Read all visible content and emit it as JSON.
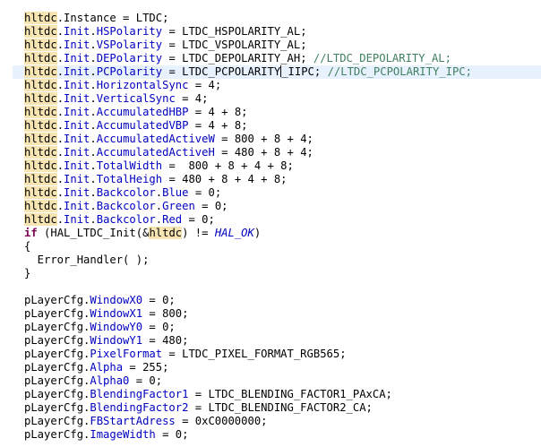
{
  "editor": {
    "caret_line": 4,
    "lines": [
      [
        {
          "t": "hl",
          "s": "hltdc"
        },
        {
          "t": "",
          "s": ".Instance = LTDC;"
        }
      ],
      [
        {
          "t": "hl",
          "s": "hltdc"
        },
        {
          "t": "",
          "s": "."
        },
        {
          "t": "fld",
          "s": "Init"
        },
        {
          "t": "",
          "s": "."
        },
        {
          "t": "fld",
          "s": "HSPolarity"
        },
        {
          "t": "",
          "s": " = LTDC_HSPOLARITY_AL;"
        }
      ],
      [
        {
          "t": "hl",
          "s": "hltdc"
        },
        {
          "t": "",
          "s": "."
        },
        {
          "t": "fld",
          "s": "Init"
        },
        {
          "t": "",
          "s": "."
        },
        {
          "t": "fld",
          "s": "VSPolarity"
        },
        {
          "t": "",
          "s": " = LTDC_VSPOLARITY_AL;"
        }
      ],
      [
        {
          "t": "hl",
          "s": "hltdc"
        },
        {
          "t": "",
          "s": "."
        },
        {
          "t": "fld",
          "s": "Init"
        },
        {
          "t": "",
          "s": "."
        },
        {
          "t": "fld",
          "s": "DEPolarity"
        },
        {
          "t": "",
          "s": " = LTDC_DEPOLARITY_AH; "
        },
        {
          "t": "cm",
          "s": "//LTDC_DEPOLARITY_AL;"
        }
      ],
      [
        {
          "t": "hl",
          "s": "hltdc"
        },
        {
          "t": "",
          "s": "."
        },
        {
          "t": "fld",
          "s": "Init"
        },
        {
          "t": "",
          "s": "."
        },
        {
          "t": "fld",
          "s": "PCPolarity"
        },
        {
          "t": "",
          "s": " = LTDC_PCPOLARITY"
        },
        {
          "t": "caret",
          "s": ""
        },
        {
          "t": "",
          "s": "_IIPC; "
        },
        {
          "t": "cm",
          "s": "//LTDC_PCPOLARITY_IPC;"
        }
      ],
      [
        {
          "t": "hl",
          "s": "hltdc"
        },
        {
          "t": "",
          "s": "."
        },
        {
          "t": "fld",
          "s": "Init"
        },
        {
          "t": "",
          "s": "."
        },
        {
          "t": "fld",
          "s": "HorizontalSync"
        },
        {
          "t": "",
          "s": " = 4;"
        }
      ],
      [
        {
          "t": "hl",
          "s": "hltdc"
        },
        {
          "t": "",
          "s": "."
        },
        {
          "t": "fld",
          "s": "Init"
        },
        {
          "t": "",
          "s": "."
        },
        {
          "t": "fld",
          "s": "VerticalSync"
        },
        {
          "t": "",
          "s": " = 4;"
        }
      ],
      [
        {
          "t": "hl",
          "s": "hltdc"
        },
        {
          "t": "",
          "s": "."
        },
        {
          "t": "fld",
          "s": "Init"
        },
        {
          "t": "",
          "s": "."
        },
        {
          "t": "fld",
          "s": "AccumulatedHBP"
        },
        {
          "t": "",
          "s": " = 4 + 8;"
        }
      ],
      [
        {
          "t": "hl",
          "s": "hltdc"
        },
        {
          "t": "",
          "s": "."
        },
        {
          "t": "fld",
          "s": "Init"
        },
        {
          "t": "",
          "s": "."
        },
        {
          "t": "fld",
          "s": "AccumulatedVBP"
        },
        {
          "t": "",
          "s": " = 4 + 8;"
        }
      ],
      [
        {
          "t": "hl",
          "s": "hltdc"
        },
        {
          "t": "",
          "s": "."
        },
        {
          "t": "fld",
          "s": "Init"
        },
        {
          "t": "",
          "s": "."
        },
        {
          "t": "fld",
          "s": "AccumulatedActiveW"
        },
        {
          "t": "",
          "s": " = 800 + 8 + 4;"
        }
      ],
      [
        {
          "t": "hl",
          "s": "hltdc"
        },
        {
          "t": "",
          "s": "."
        },
        {
          "t": "fld",
          "s": "Init"
        },
        {
          "t": "",
          "s": "."
        },
        {
          "t": "fld",
          "s": "AccumulatedActiveH"
        },
        {
          "t": "",
          "s": " = 480 + 8 + 4;"
        }
      ],
      [
        {
          "t": "hl",
          "s": "hltdc"
        },
        {
          "t": "",
          "s": "."
        },
        {
          "t": "fld",
          "s": "Init"
        },
        {
          "t": "",
          "s": "."
        },
        {
          "t": "fld",
          "s": "TotalWidth"
        },
        {
          "t": "",
          "s": " =  800 + 8 + 4 + 8;"
        }
      ],
      [
        {
          "t": "hl",
          "s": "hltdc"
        },
        {
          "t": "",
          "s": "."
        },
        {
          "t": "fld",
          "s": "Init"
        },
        {
          "t": "",
          "s": "."
        },
        {
          "t": "fld",
          "s": "TotalHeigh"
        },
        {
          "t": "",
          "s": " = 480 + 8 + 4 + 8;"
        }
      ],
      [
        {
          "t": "hl",
          "s": "hltdc"
        },
        {
          "t": "",
          "s": "."
        },
        {
          "t": "fld",
          "s": "Init"
        },
        {
          "t": "",
          "s": "."
        },
        {
          "t": "fld",
          "s": "Backcolor"
        },
        {
          "t": "",
          "s": "."
        },
        {
          "t": "fld",
          "s": "Blue"
        },
        {
          "t": "",
          "s": " = 0;"
        }
      ],
      [
        {
          "t": "hl",
          "s": "hltdc"
        },
        {
          "t": "",
          "s": "."
        },
        {
          "t": "fld",
          "s": "Init"
        },
        {
          "t": "",
          "s": "."
        },
        {
          "t": "fld",
          "s": "Backcolor"
        },
        {
          "t": "",
          "s": "."
        },
        {
          "t": "fld",
          "s": "Green"
        },
        {
          "t": "",
          "s": " = 0;"
        }
      ],
      [
        {
          "t": "hl",
          "s": "hltdc"
        },
        {
          "t": "",
          "s": "."
        },
        {
          "t": "fld",
          "s": "Init"
        },
        {
          "t": "",
          "s": "."
        },
        {
          "t": "fld",
          "s": "Backcolor"
        },
        {
          "t": "",
          "s": "."
        },
        {
          "t": "fld",
          "s": "Red"
        },
        {
          "t": "",
          "s": " = 0;"
        }
      ],
      [
        {
          "t": "kw",
          "s": "if"
        },
        {
          "t": "",
          "s": " (HAL_LTDC_Init(&"
        },
        {
          "t": "hl",
          "s": "hltdc"
        },
        {
          "t": "",
          "s": ") != "
        },
        {
          "t": "it",
          "s": "HAL_OK"
        },
        {
          "t": "",
          "s": ")"
        }
      ],
      [
        {
          "t": "",
          "s": "{"
        }
      ],
      [
        {
          "t": "",
          "s": "  Error_Handler( );"
        }
      ],
      [
        {
          "t": "",
          "s": "}"
        }
      ],
      [],
      [
        {
          "t": "",
          "s": "pLayerCfg."
        },
        {
          "t": "fld",
          "s": "WindowX0"
        },
        {
          "t": "",
          "s": " = 0;"
        }
      ],
      [
        {
          "t": "",
          "s": "pLayerCfg."
        },
        {
          "t": "fld",
          "s": "WindowX1"
        },
        {
          "t": "",
          "s": " = 800;"
        }
      ],
      [
        {
          "t": "",
          "s": "pLayerCfg."
        },
        {
          "t": "fld",
          "s": "WindowY0"
        },
        {
          "t": "",
          "s": " = 0;"
        }
      ],
      [
        {
          "t": "",
          "s": "pLayerCfg."
        },
        {
          "t": "fld",
          "s": "WindowY1"
        },
        {
          "t": "",
          "s": " = 480;"
        }
      ],
      [
        {
          "t": "",
          "s": "pLayerCfg."
        },
        {
          "t": "fld",
          "s": "PixelFormat"
        },
        {
          "t": "",
          "s": " = LTDC_PIXEL_FORMAT_RGB565;"
        }
      ],
      [
        {
          "t": "",
          "s": "pLayerCfg."
        },
        {
          "t": "fld",
          "s": "Alpha"
        },
        {
          "t": "",
          "s": " = 255;"
        }
      ],
      [
        {
          "t": "",
          "s": "pLayerCfg."
        },
        {
          "t": "fld",
          "s": "Alpha0"
        },
        {
          "t": "",
          "s": " = 0;"
        }
      ],
      [
        {
          "t": "",
          "s": "pLayerCfg."
        },
        {
          "t": "fld",
          "s": "BlendingFactor1"
        },
        {
          "t": "",
          "s": " = LTDC_BLENDING_FACTOR1_PAxCA;"
        }
      ],
      [
        {
          "t": "",
          "s": "pLayerCfg."
        },
        {
          "t": "fld",
          "s": "BlendingFactor2"
        },
        {
          "t": "",
          "s": " = LTDC_BLENDING_FACTOR2_CA;"
        }
      ],
      [
        {
          "t": "",
          "s": "pLayerCfg."
        },
        {
          "t": "fld",
          "s": "FBStartAdress"
        },
        {
          "t": "",
          "s": " = 0xC0000000;"
        }
      ],
      [
        {
          "t": "",
          "s": "pLayerCfg."
        },
        {
          "t": "fld",
          "s": "ImageWidth"
        },
        {
          "t": "",
          "s": " = 0;"
        }
      ]
    ]
  }
}
